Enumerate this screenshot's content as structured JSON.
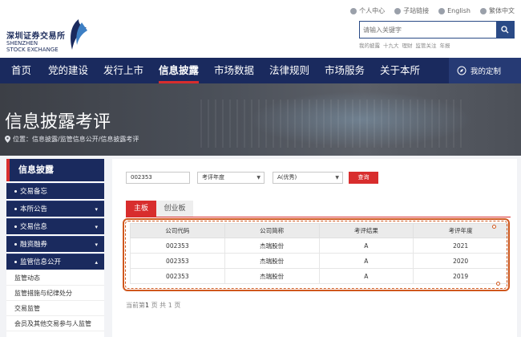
{
  "logo": {
    "cn": "深圳证券交易所",
    "en_line1": "SHENZHEN",
    "en_line2": "STOCK EXCHANGE"
  },
  "top_links": [
    {
      "label": "个人中心",
      "icon": "person-icon"
    },
    {
      "label": "子站链接",
      "icon": "link-icon"
    },
    {
      "label": "English",
      "icon": "globe-icon"
    },
    {
      "label": "繁体中文",
      "icon": "language-icon"
    }
  ],
  "search": {
    "placeholder": "请输入关键字",
    "hot_words": [
      "我的披露",
      "十九大",
      "理财",
      "监管关注",
      "年报"
    ]
  },
  "nav": {
    "items": [
      "首页",
      "党的建设",
      "发行上市",
      "信息披露",
      "市场数据",
      "法律规则",
      "市场服务",
      "关于本所"
    ],
    "active": "信息披露",
    "custom_label": "我的定制"
  },
  "banner": {
    "title": "信息披露考评",
    "breadcrumb": "位置：信息披露/监管信息公开/信息披露考评"
  },
  "sidebar": {
    "title": "信息披露",
    "items": [
      {
        "label": "交易备忘",
        "arrow": ""
      },
      {
        "label": "本所公告",
        "arrow": "▾"
      },
      {
        "label": "交易信息",
        "arrow": "▾"
      },
      {
        "label": "融资融券",
        "arrow": "▾"
      },
      {
        "label": "监管信息公开",
        "arrow": "▴"
      }
    ],
    "sub_items": [
      "监管动态",
      "监管措施与纪律处分",
      "交易监管",
      "会员及其他交易参与人监管"
    ]
  },
  "filters": {
    "code_value": "002353",
    "year_select": "考评年度",
    "result_select": "A(优秀)",
    "query_label": "查询"
  },
  "tabs": [
    {
      "label": "主板",
      "active": true
    },
    {
      "label": "创业板",
      "active": false
    }
  ],
  "table": {
    "headers": [
      "公司代码",
      "公司简称",
      "考评结果",
      "考评年度"
    ],
    "rows": [
      [
        "002353",
        "杰瑞股份",
        "A",
        "2021"
      ],
      [
        "002353",
        "杰瑞股份",
        "A",
        "2020"
      ],
      [
        "002353",
        "杰瑞股份",
        "A",
        "2019"
      ]
    ]
  },
  "pager": {
    "prefix": "当前第",
    "current": "1",
    "mid": "页 共",
    "total": "1",
    "suffix": "页"
  },
  "colors": {
    "navy": "#1a2a5e",
    "accent_red": "#d82d2d",
    "highlight": "#d0581e"
  }
}
